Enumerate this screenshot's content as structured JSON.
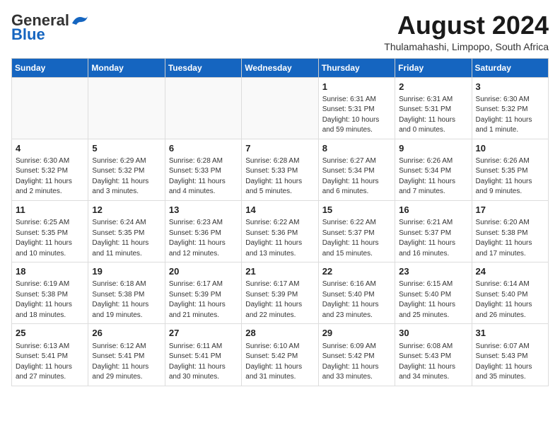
{
  "header": {
    "logo_general": "General",
    "logo_blue": "Blue",
    "month_title": "August 2024",
    "location": "Thulamahashi, Limpopo, South Africa"
  },
  "weekdays": [
    "Sunday",
    "Monday",
    "Tuesday",
    "Wednesday",
    "Thursday",
    "Friday",
    "Saturday"
  ],
  "weeks": [
    [
      {
        "day": "",
        "info": ""
      },
      {
        "day": "",
        "info": ""
      },
      {
        "day": "",
        "info": ""
      },
      {
        "day": "",
        "info": ""
      },
      {
        "day": "1",
        "info": "Sunrise: 6:31 AM\nSunset: 5:31 PM\nDaylight: 10 hours\nand 59 minutes."
      },
      {
        "day": "2",
        "info": "Sunrise: 6:31 AM\nSunset: 5:31 PM\nDaylight: 11 hours\nand 0 minutes."
      },
      {
        "day": "3",
        "info": "Sunrise: 6:30 AM\nSunset: 5:32 PM\nDaylight: 11 hours\nand 1 minute."
      }
    ],
    [
      {
        "day": "4",
        "info": "Sunrise: 6:30 AM\nSunset: 5:32 PM\nDaylight: 11 hours\nand 2 minutes."
      },
      {
        "day": "5",
        "info": "Sunrise: 6:29 AM\nSunset: 5:32 PM\nDaylight: 11 hours\nand 3 minutes."
      },
      {
        "day": "6",
        "info": "Sunrise: 6:28 AM\nSunset: 5:33 PM\nDaylight: 11 hours\nand 4 minutes."
      },
      {
        "day": "7",
        "info": "Sunrise: 6:28 AM\nSunset: 5:33 PM\nDaylight: 11 hours\nand 5 minutes."
      },
      {
        "day": "8",
        "info": "Sunrise: 6:27 AM\nSunset: 5:34 PM\nDaylight: 11 hours\nand 6 minutes."
      },
      {
        "day": "9",
        "info": "Sunrise: 6:26 AM\nSunset: 5:34 PM\nDaylight: 11 hours\nand 7 minutes."
      },
      {
        "day": "10",
        "info": "Sunrise: 6:26 AM\nSunset: 5:35 PM\nDaylight: 11 hours\nand 9 minutes."
      }
    ],
    [
      {
        "day": "11",
        "info": "Sunrise: 6:25 AM\nSunset: 5:35 PM\nDaylight: 11 hours\nand 10 minutes."
      },
      {
        "day": "12",
        "info": "Sunrise: 6:24 AM\nSunset: 5:35 PM\nDaylight: 11 hours\nand 11 minutes."
      },
      {
        "day": "13",
        "info": "Sunrise: 6:23 AM\nSunset: 5:36 PM\nDaylight: 11 hours\nand 12 minutes."
      },
      {
        "day": "14",
        "info": "Sunrise: 6:22 AM\nSunset: 5:36 PM\nDaylight: 11 hours\nand 13 minutes."
      },
      {
        "day": "15",
        "info": "Sunrise: 6:22 AM\nSunset: 5:37 PM\nDaylight: 11 hours\nand 15 minutes."
      },
      {
        "day": "16",
        "info": "Sunrise: 6:21 AM\nSunset: 5:37 PM\nDaylight: 11 hours\nand 16 minutes."
      },
      {
        "day": "17",
        "info": "Sunrise: 6:20 AM\nSunset: 5:38 PM\nDaylight: 11 hours\nand 17 minutes."
      }
    ],
    [
      {
        "day": "18",
        "info": "Sunrise: 6:19 AM\nSunset: 5:38 PM\nDaylight: 11 hours\nand 18 minutes."
      },
      {
        "day": "19",
        "info": "Sunrise: 6:18 AM\nSunset: 5:38 PM\nDaylight: 11 hours\nand 19 minutes."
      },
      {
        "day": "20",
        "info": "Sunrise: 6:17 AM\nSunset: 5:39 PM\nDaylight: 11 hours\nand 21 minutes."
      },
      {
        "day": "21",
        "info": "Sunrise: 6:17 AM\nSunset: 5:39 PM\nDaylight: 11 hours\nand 22 minutes."
      },
      {
        "day": "22",
        "info": "Sunrise: 6:16 AM\nSunset: 5:40 PM\nDaylight: 11 hours\nand 23 minutes."
      },
      {
        "day": "23",
        "info": "Sunrise: 6:15 AM\nSunset: 5:40 PM\nDaylight: 11 hours\nand 25 minutes."
      },
      {
        "day": "24",
        "info": "Sunrise: 6:14 AM\nSunset: 5:40 PM\nDaylight: 11 hours\nand 26 minutes."
      }
    ],
    [
      {
        "day": "25",
        "info": "Sunrise: 6:13 AM\nSunset: 5:41 PM\nDaylight: 11 hours\nand 27 minutes."
      },
      {
        "day": "26",
        "info": "Sunrise: 6:12 AM\nSunset: 5:41 PM\nDaylight: 11 hours\nand 29 minutes."
      },
      {
        "day": "27",
        "info": "Sunrise: 6:11 AM\nSunset: 5:41 PM\nDaylight: 11 hours\nand 30 minutes."
      },
      {
        "day": "28",
        "info": "Sunrise: 6:10 AM\nSunset: 5:42 PM\nDaylight: 11 hours\nand 31 minutes."
      },
      {
        "day": "29",
        "info": "Sunrise: 6:09 AM\nSunset: 5:42 PM\nDaylight: 11 hours\nand 33 minutes."
      },
      {
        "day": "30",
        "info": "Sunrise: 6:08 AM\nSunset: 5:43 PM\nDaylight: 11 hours\nand 34 minutes."
      },
      {
        "day": "31",
        "info": "Sunrise: 6:07 AM\nSunset: 5:43 PM\nDaylight: 11 hours\nand 35 minutes."
      }
    ]
  ]
}
